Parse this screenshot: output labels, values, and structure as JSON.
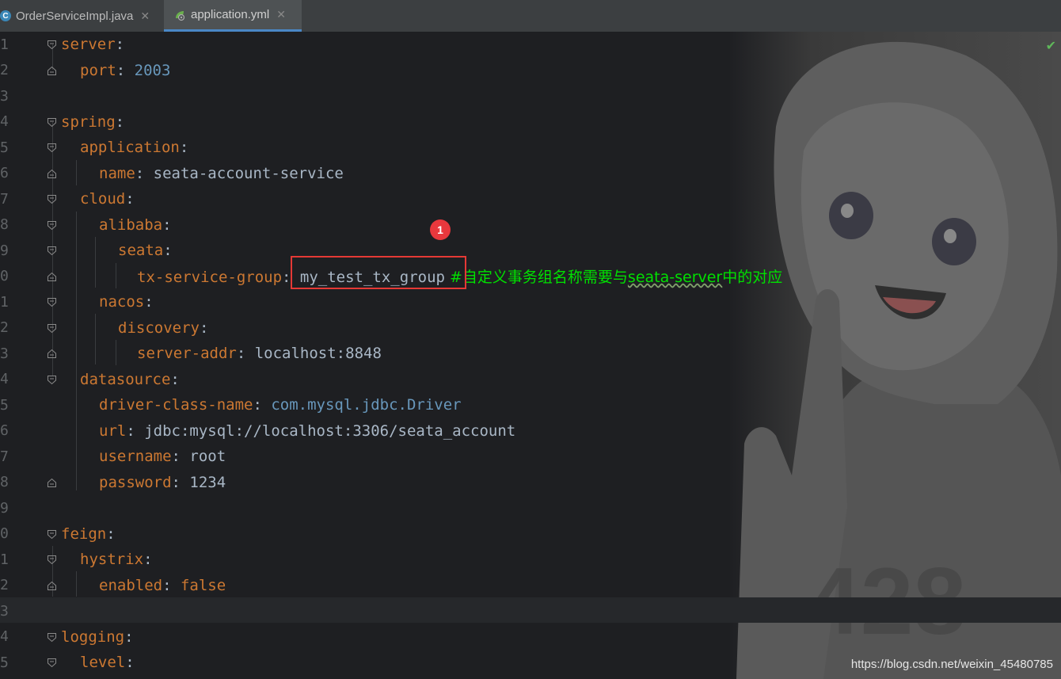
{
  "tabs": [
    {
      "label": "OrderServiceImpl.java",
      "icon": "java-class-icon",
      "active": false
    },
    {
      "label": "application.yml",
      "icon": "spring-yml-icon",
      "active": true
    }
  ],
  "annotation_badge": "1",
  "watermark": "https://blog.csdn.net/weixin_45480785",
  "lines": [
    {
      "num": "1",
      "key": "server",
      "sep": ":",
      "value": "",
      "value_type": "",
      "comment": ""
    },
    {
      "num": "2",
      "key": "port",
      "sep": ": ",
      "value": "2003",
      "value_type": "number",
      "comment": ""
    },
    {
      "num": "3",
      "key": "",
      "sep": "",
      "value": "",
      "value_type": "",
      "comment": ""
    },
    {
      "num": "4",
      "key": "spring",
      "sep": ":",
      "value": "",
      "value_type": "",
      "comment": ""
    },
    {
      "num": "5",
      "key": "application",
      "sep": ":",
      "value": "",
      "value_type": "",
      "comment": ""
    },
    {
      "num": "6",
      "key": "name",
      "sep": ": ",
      "value": "seata-account-service",
      "value_type": "string",
      "comment": ""
    },
    {
      "num": "7",
      "key": "cloud",
      "sep": ":",
      "value": "",
      "value_type": "",
      "comment": ""
    },
    {
      "num": "8",
      "key": "alibaba",
      "sep": ":",
      "value": "",
      "value_type": "",
      "comment": ""
    },
    {
      "num": "9",
      "key": "seata",
      "sep": ":",
      "value": "",
      "value_type": "",
      "comment": ""
    },
    {
      "num": "0",
      "key": "tx-service-group",
      "sep": ": ",
      "value": "my_test_tx_group",
      "value_type": "string",
      "comment": "#自定义事务组名称需要与",
      "comment_squiggly": "seata-server",
      "comment_tail": "中的对应"
    },
    {
      "num": "1",
      "key": "nacos",
      "sep": ":",
      "value": "",
      "value_type": "",
      "comment": ""
    },
    {
      "num": "2",
      "key": "discovery",
      "sep": ":",
      "value": "",
      "value_type": "",
      "comment": ""
    },
    {
      "num": "3",
      "key": "server-addr",
      "sep": ": ",
      "value": "localhost:8848",
      "value_type": "string",
      "comment": ""
    },
    {
      "num": "4",
      "key": "datasource",
      "sep": ":",
      "value": "",
      "value_type": "",
      "comment": ""
    },
    {
      "num": "5",
      "key": "driver-class-name",
      "sep": ": ",
      "value": "com.mysql.jdbc.Driver",
      "value_type": "class",
      "comment": ""
    },
    {
      "num": "6",
      "key": "url",
      "sep": ": ",
      "value": "jdbc:mysql://localhost:3306/seata_account",
      "value_type": "string",
      "comment": ""
    },
    {
      "num": "7",
      "key": "username",
      "sep": ": ",
      "value": "root",
      "value_type": "string",
      "comment": ""
    },
    {
      "num": "8",
      "key": "password",
      "sep": ": ",
      "value": "1234",
      "value_type": "string",
      "comment": ""
    },
    {
      "num": "9",
      "key": "",
      "sep": "",
      "value": "",
      "value_type": "",
      "comment": ""
    },
    {
      "num": "0",
      "key": "feign",
      "sep": ":",
      "value": "",
      "value_type": "",
      "comment": ""
    },
    {
      "num": "1",
      "key": "hystrix",
      "sep": ":",
      "value": "",
      "value_type": "",
      "comment": ""
    },
    {
      "num": "2",
      "key": "enabled",
      "sep": ": ",
      "value": "false",
      "value_type": "keyword",
      "comment": ""
    },
    {
      "num": "3",
      "key": "",
      "sep": "",
      "value": "",
      "value_type": "",
      "comment": ""
    },
    {
      "num": "4",
      "key": "logging",
      "sep": ":",
      "value": "",
      "value_type": "",
      "comment": ""
    },
    {
      "num": "5",
      "key": "level",
      "sep": ":",
      "value": "",
      "value_type": "",
      "comment": ""
    }
  ]
}
